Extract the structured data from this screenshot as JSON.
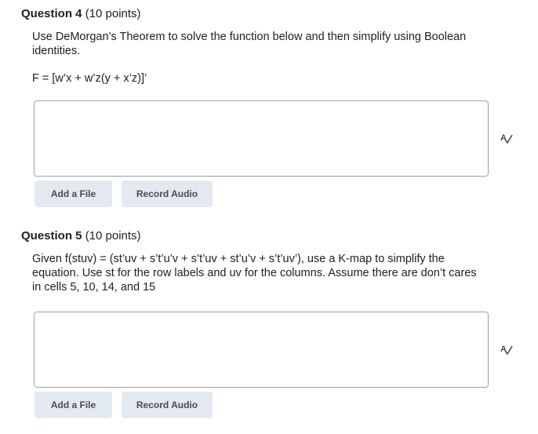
{
  "q4": {
    "title": "Question 4",
    "points": "(10 points)",
    "text": "Use DeMorgan’s Theorem to solve the function below and then simplify using Boolean identities.",
    "formula": "F = [w’x + w’z(y + x’z)]’",
    "add_file_label": "Add a File",
    "record_audio_label": "Record Audio",
    "spellcheck_icon": "spellcheck-icon"
  },
  "q5": {
    "title": "Question 5",
    "points": "(10 points)",
    "text": "Given f(stuv) = (st’uv + s’t’u’v + s’t’uv + st’u’v + s’t’uv’), use a K-map to simplify the equation. Use st for the row labels and uv for the columns. Assume there are don’t cares in cells 5, 10, 14, and 15",
    "add_file_label": "Add a File",
    "record_audio_label": "Record Audio",
    "spellcheck_icon": "spellcheck-icon"
  },
  "colors": {
    "button_bg": "#e3e9f1",
    "border": "#9ea2a6",
    "text": "#202122"
  }
}
